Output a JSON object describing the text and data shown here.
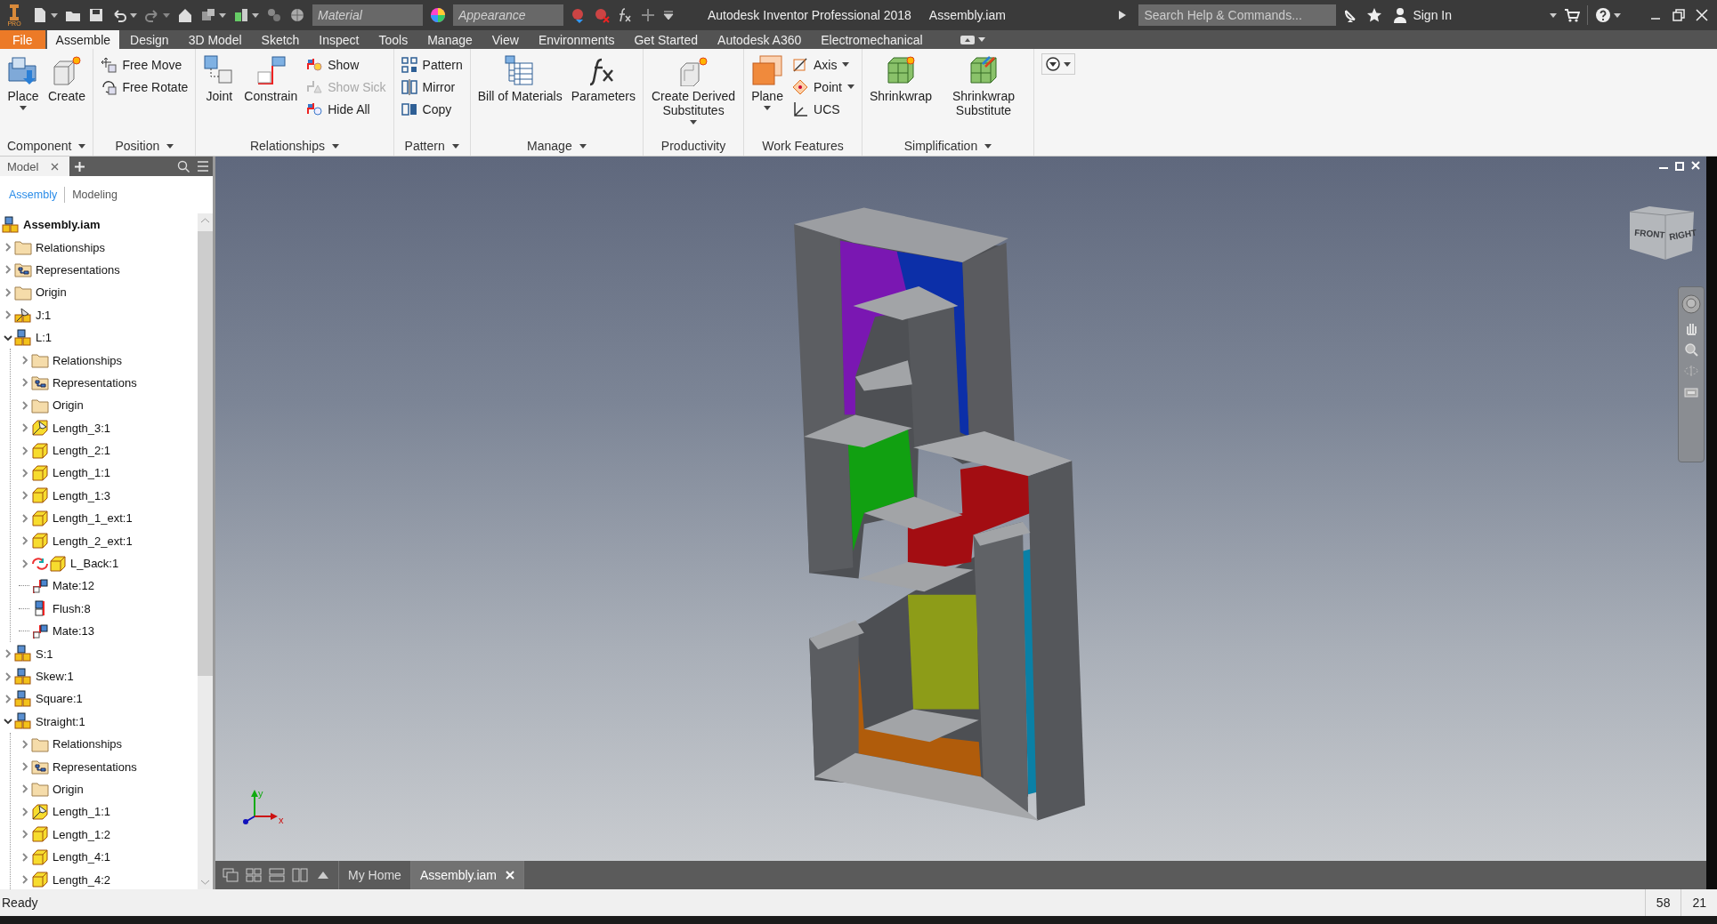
{
  "title_bar": {
    "app_badge": "PRO",
    "material": {
      "placeholder": "Material"
    },
    "appearance": {
      "placeholder": "Appearance"
    },
    "title": "Autodesk Inventor Professional 2018",
    "document": "Assembly.iam",
    "search": {
      "placeholder": "Search Help & Commands..."
    },
    "sign_in": "Sign In"
  },
  "ribbon_tabs": [
    {
      "label": "File",
      "kind": "file",
      "selected": false
    },
    {
      "label": "Assemble",
      "kind": "tab",
      "selected": true
    },
    {
      "label": "Design",
      "kind": "tab",
      "selected": false
    },
    {
      "label": "3D Model",
      "kind": "tab",
      "selected": false
    },
    {
      "label": "Sketch",
      "kind": "tab",
      "selected": false
    },
    {
      "label": "Inspect",
      "kind": "tab",
      "selected": false
    },
    {
      "label": "Tools",
      "kind": "tab",
      "selected": false
    },
    {
      "label": "Manage",
      "kind": "tab",
      "selected": false
    },
    {
      "label": "View",
      "kind": "tab",
      "selected": false
    },
    {
      "label": "Environments",
      "kind": "tab",
      "selected": false
    },
    {
      "label": "Get Started",
      "kind": "tab",
      "selected": false
    },
    {
      "label": "Autodesk A360",
      "kind": "tab",
      "selected": false
    },
    {
      "label": "Electromechanical",
      "kind": "tab",
      "selected": false
    }
  ],
  "ribbon_panels": [
    {
      "title": "Component",
      "menu": true,
      "tools": [
        {
          "label": "Place",
          "kind": "large",
          "menu": true,
          "disabled": false
        },
        {
          "label": "Create",
          "kind": "large",
          "menu": false,
          "disabled": false
        }
      ]
    },
    {
      "title": "Position",
      "menu": true,
      "tools": [
        {
          "label": "Free Move",
          "kind": "small",
          "menu": false,
          "disabled": false
        },
        {
          "label": "Free Rotate",
          "kind": "small",
          "menu": false,
          "disabled": false
        }
      ]
    },
    {
      "title": "Relationships",
      "menu": true,
      "tools": [
        {
          "label": "Joint",
          "kind": "large",
          "menu": false,
          "disabled": false
        },
        {
          "label": "Constrain",
          "kind": "large",
          "menu": false,
          "disabled": false
        },
        {
          "label": "Show",
          "kind": "small",
          "menu": false,
          "disabled": false
        },
        {
          "label": "Show Sick",
          "kind": "small",
          "menu": false,
          "disabled": true
        },
        {
          "label": "Hide All",
          "kind": "small",
          "menu": false,
          "disabled": false
        }
      ]
    },
    {
      "title": "Pattern",
      "menu": true,
      "tools": [
        {
          "label": "Pattern",
          "kind": "small",
          "menu": false,
          "disabled": false
        },
        {
          "label": "Mirror",
          "kind": "small",
          "menu": false,
          "disabled": false
        },
        {
          "label": "Copy",
          "kind": "small",
          "menu": false,
          "disabled": false
        }
      ]
    },
    {
      "title": "Manage",
      "menu": true,
      "tools": [
        {
          "label": "Bill of Materials",
          "kind": "large",
          "menu": false,
          "disabled": false
        },
        {
          "label": "Parameters",
          "kind": "large",
          "menu": false,
          "disabled": false
        }
      ]
    },
    {
      "title": "Productivity",
      "menu": false,
      "tools": [
        {
          "label": "Create Derived Substitutes",
          "kind": "large",
          "menu": true,
          "disabled": false
        }
      ]
    },
    {
      "title": "Work Features",
      "menu": false,
      "tools": [
        {
          "label": "Plane",
          "kind": "large",
          "menu": true,
          "disabled": false
        },
        {
          "label": "Axis",
          "kind": "small",
          "menu": true,
          "disabled": false
        },
        {
          "label": "Point",
          "kind": "small",
          "menu": true,
          "disabled": false
        },
        {
          "label": "UCS",
          "kind": "small",
          "menu": false,
          "disabled": false
        }
      ]
    },
    {
      "title": "Simplification",
      "menu": true,
      "tools": [
        {
          "label": "Shrinkwrap",
          "kind": "large",
          "menu": false,
          "disabled": false
        },
        {
          "label": "Shrinkwrap Substitute",
          "kind": "large",
          "menu": false,
          "disabled": false
        }
      ]
    }
  ],
  "browser": {
    "tabs": [
      {
        "label": "Model",
        "selected": true
      }
    ],
    "subtabs": [
      {
        "label": "Assembly",
        "selected": true
      },
      {
        "label": "Modeling",
        "selected": false
      }
    ],
    "tree": {
      "label": "Assembly.iam",
      "kind": "assembly",
      "children": [
        {
          "label": "Relationships",
          "kind": "folder",
          "expanded": false
        },
        {
          "label": "Representations",
          "kind": "representations",
          "expanded": false
        },
        {
          "label": "Origin",
          "kind": "folder",
          "expanded": false
        },
        {
          "label": "J:1",
          "kind": "grounded-assembly",
          "expanded": false
        },
        {
          "label": "L:1",
          "kind": "assembly",
          "expanded": true,
          "children": [
            {
              "label": "Relationships",
              "kind": "folder",
              "expanded": false
            },
            {
              "label": "Representations",
              "kind": "representations",
              "expanded": false
            },
            {
              "label": "Origin",
              "kind": "folder",
              "expanded": false
            },
            {
              "label": "Length_3:1",
              "kind": "grounded-part",
              "expanded": false
            },
            {
              "label": "Length_2:1",
              "kind": "part",
              "expanded": false
            },
            {
              "label": "Length_1:1",
              "kind": "part",
              "expanded": false
            },
            {
              "label": "Length_1:3",
              "kind": "part",
              "expanded": false
            },
            {
              "label": "Length_1_ext:1",
              "kind": "part",
              "expanded": false
            },
            {
              "label": "Length_2_ext:1",
              "kind": "part",
              "expanded": false
            },
            {
              "label": "L_Back:1",
              "kind": "update-part",
              "expanded": false
            },
            {
              "label": "Mate:12",
              "kind": "mate"
            },
            {
              "label": "Flush:8",
              "kind": "flush"
            },
            {
              "label": "Mate:13",
              "kind": "mate"
            }
          ]
        },
        {
          "label": "S:1",
          "kind": "assembly",
          "expanded": false
        },
        {
          "label": "Skew:1",
          "kind": "assembly",
          "expanded": false
        },
        {
          "label": "Square:1",
          "kind": "assembly",
          "expanded": false
        },
        {
          "label": "Straight:1",
          "kind": "assembly",
          "expanded": true,
          "children": [
            {
              "label": "Relationships",
              "kind": "folder",
              "expanded": false
            },
            {
              "label": "Representations",
              "kind": "representations",
              "expanded": false
            },
            {
              "label": "Origin",
              "kind": "folder",
              "expanded": false
            },
            {
              "label": "Length_1:1",
              "kind": "grounded-part",
              "expanded": false
            },
            {
              "label": "Length_1:2",
              "kind": "part",
              "expanded": false
            },
            {
              "label": "Length_4:1",
              "kind": "part",
              "expanded": false
            },
            {
              "label": "Length_4:2",
              "kind": "part",
              "expanded": false
            }
          ]
        }
      ]
    }
  },
  "viewport": {
    "viewcube": {
      "faces": [
        "FRONT",
        "RIGHT"
      ]
    },
    "triad": [
      "y",
      "x"
    ]
  },
  "doc_tabs": [
    {
      "label": "My Home",
      "selected": false
    },
    {
      "label": "Assembly.iam",
      "selected": true
    }
  ],
  "status_bar": {
    "message": "Ready",
    "fields": [
      "58",
      "21"
    ]
  }
}
